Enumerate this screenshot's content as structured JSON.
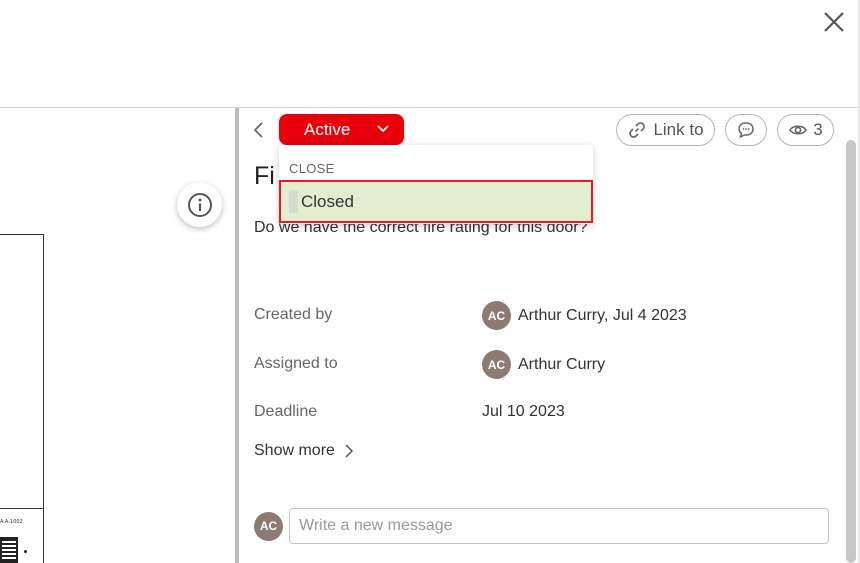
{
  "header": {
    "close_icon": "close-icon"
  },
  "drawing": {
    "tiny_label": "A.A-1002"
  },
  "status": {
    "label": "Active",
    "color": "#e8000b"
  },
  "toolbar": {
    "link_label": "Link to",
    "watchers_count": "3"
  },
  "dropdown": {
    "section_header": "CLOSE",
    "items": [
      {
        "label": "Closed"
      }
    ]
  },
  "issue": {
    "title": "Fi",
    "description": "Do we have the correct fire rating for this door?"
  },
  "details": {
    "created_by_label": "Created by",
    "created_by_initials": "AC",
    "created_by_value": "Arthur Curry, Jul 4 2023",
    "assigned_to_label": "Assigned to",
    "assigned_to_initials": "AC",
    "assigned_to_value": "Arthur Curry",
    "deadline_label": "Deadline",
    "deadline_value": "Jul 10 2023",
    "show_more_label": "Show more"
  },
  "message": {
    "avatar_initials": "AC",
    "placeholder": "Write a new message"
  }
}
